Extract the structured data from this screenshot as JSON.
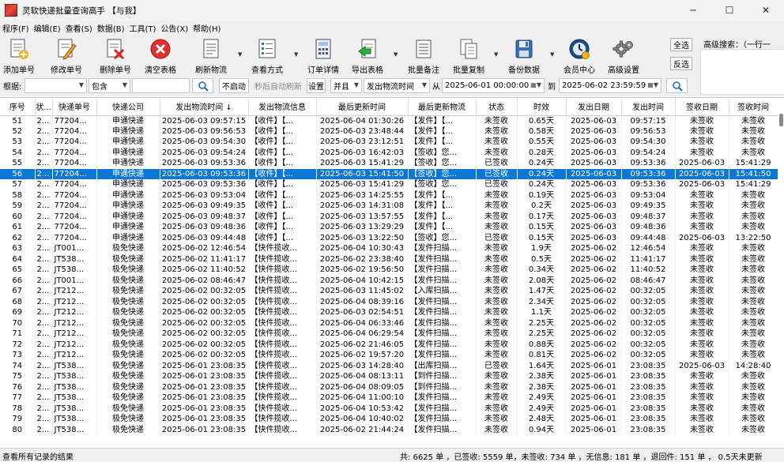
{
  "window": {
    "title": "灵软快递批量查询高手 【与我】",
    "minimize": "─",
    "maximize": "☐",
    "close": "✕"
  },
  "menu": [
    "程序(F)",
    "编辑(E)",
    "查看(S)",
    "数据(B)",
    "工具(T)",
    "公告(X)",
    "帮助(H)"
  ],
  "toolbar": {
    "add": "添加单号",
    "edit": "修改单号",
    "delete": "删除单号",
    "clear": "清空表格",
    "refresh": "刷新物流",
    "view": "查看方式",
    "detail": "订单详情",
    "export": "导出表格",
    "batch_note": "批量备注",
    "batch_copy": "批量复制",
    "backup": "备份数据",
    "member": "会员中心",
    "advanced": "高级设置",
    "select_all": "全选",
    "invert": "反选",
    "adv_search": "高级搜索：（一行一"
  },
  "filter": {
    "basis_label": "根据:",
    "basis_value": "",
    "contain_value": "包含",
    "text_value": "",
    "no_auto": "不启动",
    "auto_refresh": "秒后自动刷新",
    "settings": "设置",
    "logic": "并且",
    "time_field": "发出物流时间",
    "from_label": "从",
    "from": "2025-06-01 00:00:00",
    "to_label": "到",
    "to": "2025-06-02 23:59:59"
  },
  "columns": [
    "序号",
    "状...",
    "快递单号",
    "快递公司",
    "发出物流时间 ↓",
    "发出物流信息",
    "最后更新时间",
    "最后更新物流",
    "状态",
    "时效",
    "发出日期",
    "发出时间",
    "签收日期",
    "签收时间"
  ],
  "rows": [
    [
      "51",
      "2...",
      "77204...",
      "申通快递",
      "2025-06-03 09:57:15",
      "【收件】【...",
      "2025-06-04 01:30:26",
      "【发件】【...",
      "未签收",
      "0.65天",
      "2025-06-03",
      "09:57:15",
      "未签收",
      "未签收"
    ],
    [
      "52",
      "2...",
      "77204...",
      "申通快递",
      "2025-06-03 09:56:53",
      "【收件】【...",
      "2025-06-03 23:48:44",
      "【发件】【...",
      "未签收",
      "0.58天",
      "2025-06-03",
      "09:56:53",
      "未签收",
      "未签收"
    ],
    [
      "53",
      "2...",
      "77204...",
      "申通快递",
      "2025-06-03 09:54:30",
      "【收件】【...",
      "2025-06-03 23:12:51",
      "【发件】【...",
      "未签收",
      "0.55天",
      "2025-06-03",
      "09:54:30",
      "未签收",
      "未签收"
    ],
    [
      "54",
      "2...",
      "77204...",
      "申通快递",
      "2025-06-03 09:54:24",
      "【收件】【...",
      "2025-06-03 16:42:03",
      "【签收】您...",
      "未签收",
      "0.28天",
      "2025-06-03",
      "09:54:24",
      "未签收",
      "未签收"
    ],
    [
      "55",
      "2...",
      "77204...",
      "申通快递",
      "2025-06-03 09:53:36",
      "【收件】【...",
      "2025-06-03 15:41:29",
      "【签收】您...",
      "已签收",
      "0.24天",
      "2025-06-03",
      "09:53:36",
      "2025-06-03",
      "15:41:29"
    ],
    [
      "56",
      "2...",
      "77204...",
      "申通快递",
      "2025-06-03 09:53:36",
      "【收件】【...",
      "2025-06-03 15:41:50",
      "【签收】您...",
      "已签收",
      "0.24天",
      "2025-06-03",
      "09:53:36",
      "2025-06-03",
      "15:41:50"
    ],
    [
      "57",
      "2...",
      "77204...",
      "申通快递",
      "2025-06-03 09:53:36",
      "【收件】【...",
      "2025-06-03 15:41:29",
      "【签收】您...",
      "已签收",
      "0.24天",
      "2025-06-03",
      "09:53:36",
      "2025-06-03",
      "15:41:29"
    ],
    [
      "58",
      "2...",
      "77204...",
      "申通快递",
      "2025-06-03 09:53:04",
      "【收件】【...",
      "2025-06-03 14:25:55",
      "【发件】【...",
      "未签收",
      "0.19天",
      "2025-06-03",
      "09:53:04",
      "未签收",
      "未签收"
    ],
    [
      "59",
      "2...",
      "77204...",
      "申通快递",
      "2025-06-03 09:49:35",
      "【收件】【...",
      "2025-06-03 14:31:08",
      "【发件】【...",
      "未签收",
      "0.2天",
      "2025-06-03",
      "09:49:35",
      "未签收",
      "未签收"
    ],
    [
      "60",
      "2...",
      "77204...",
      "申通快递",
      "2025-06-03 09:48:37",
      "【收件】【...",
      "2025-06-03 13:57:55",
      "【发件】【...",
      "未签收",
      "0.17天",
      "2025-06-03",
      "09:48:37",
      "未签收",
      "未签收"
    ],
    [
      "61",
      "2...",
      "77204...",
      "申通快递",
      "2025-06-03 09:48:36",
      "【收件】【...",
      "2025-06-03 13:29:29",
      "【发件】【...",
      "未签收",
      "0.15天",
      "2025-06-03",
      "09:48:36",
      "未签收",
      "未签收"
    ],
    [
      "62",
      "2...",
      "77204...",
      "申通快递",
      "2025-06-03 09:44:48",
      "【收件】【...",
      "2025-06-03 13:22:50",
      "【签收】您...",
      "已签收",
      "0.15天",
      "2025-06-03",
      "09:44:48",
      "2025-06-03",
      "13:22:50"
    ],
    [
      "63",
      "2...",
      "JT001...",
      "极免快递",
      "2025-06-02 12:46:54",
      "【快件揽收...",
      "2025-06-04 10:30:43",
      "【发件扫描...",
      "未签收",
      "1.9天",
      "2025-06-02",
      "12:46:54",
      "未签收",
      "未签收"
    ],
    [
      "64",
      "2...",
      "JT538...",
      "极免快递",
      "2025-06-02 11:41:17",
      "【快件揽收...",
      "2025-06-02 23:38:40",
      "【发件扫描...",
      "未签收",
      "0.5天",
      "2025-06-02",
      "11:41:17",
      "未签收",
      "未签收"
    ],
    [
      "65",
      "2...",
      "JT538...",
      "极免快递",
      "2025-06-02 11:40:52",
      "【快件揽收...",
      "2025-06-02 19:56:50",
      "【发件扫描...",
      "未签收",
      "0.34天",
      "2025-06-02",
      "11:40:52",
      "未签收",
      "未签收"
    ],
    [
      "66",
      "2...",
      "JT001...",
      "极免快递",
      "2025-06-02 08:46:47",
      "【快件揽收...",
      "2025-06-04 10:42:15",
      "【发件扫描...",
      "未签收",
      "2.08天",
      "2025-06-02",
      "08:46:47",
      "未签收",
      "未签收"
    ],
    [
      "67",
      "2...",
      "JT212...",
      "极免快递",
      "2025-06-02 00:32:05",
      "【快件揽收...",
      "2025-06-03 11:45:02",
      "【入库扫描...",
      "未签收",
      "1.47天",
      "2025-06-02",
      "00:32:05",
      "未签收",
      "未签收"
    ],
    [
      "68",
      "2...",
      "JT212...",
      "极免快递",
      "2025-06-02 00:32:05",
      "【快件揽收...",
      "2025-06-04 08:39:16",
      "【发件扫描...",
      "未签收",
      "2.34天",
      "2025-06-02",
      "00:32:05",
      "未签收",
      "未签收"
    ],
    [
      "69",
      "2...",
      "JT212...",
      "极免快递",
      "2025-06-02 00:32:05",
      "【快件揽收...",
      "2025-06-03 02:54:51",
      "【发件扫描...",
      "未签收",
      "1.1天",
      "2025-06-02",
      "00:32:05",
      "未签收",
      "未签收"
    ],
    [
      "70",
      "2...",
      "JT212...",
      "极免快递",
      "2025-06-02 00:32:05",
      "【快件揽收...",
      "2025-06-04 06:33:46",
      "【发件扫描...",
      "未签收",
      "2.25天",
      "2025-06-02",
      "00:32:05",
      "未签收",
      "未签收"
    ],
    [
      "71",
      "2...",
      "JT212...",
      "极免快递",
      "2025-06-02 00:32:05",
      "【快件揽收...",
      "2025-06-04 06:29:54",
      "【发件扫描...",
      "未签收",
      "2.25天",
      "2025-06-02",
      "00:32:05",
      "未签收",
      "未签收"
    ],
    [
      "72",
      "2...",
      "JT212...",
      "极免快递",
      "2025-06-02 00:32:05",
      "【快件揽收...",
      "2025-06-02 21:46:05",
      "【发件扫描...",
      "未签收",
      "0.88天",
      "2025-06-02",
      "00:32:05",
      "未签收",
      "未签收"
    ],
    [
      "73",
      "2...",
      "JT212...",
      "极免快递",
      "2025-06-02 00:32:05",
      "【快件揽收...",
      "2025-06-02 19:57:20",
      "【发件扫描...",
      "未签收",
      "0.81天",
      "2025-06-02",
      "00:32:05",
      "未签收",
      "未签收"
    ],
    [
      "74",
      "2...",
      "JT538...",
      "极免快递",
      "2025-06-01 23:08:35",
      "【快件揽收...",
      "2025-06-03 14:28:40",
      "【出库扫描...",
      "已签收",
      "1.64天",
      "2025-06-01",
      "23:08:35",
      "2025-06-03",
      "14:28:40"
    ],
    [
      "75",
      "2...",
      "JT538...",
      "极免快递",
      "2025-06-01 23:08:35",
      "【快件揽收...",
      "2025-06-04 08:13:11",
      "【到件扫描...",
      "未签收",
      "2.38天",
      "2025-06-01",
      "23:08:35",
      "未签收",
      "未签收"
    ],
    [
      "76",
      "2...",
      "JT538...",
      "极免快递",
      "2025-06-01 23:08:35",
      "【快件揽收...",
      "2025-06-04 08:09:05",
      "【到件扫描...",
      "未签收",
      "2.38天",
      "2025-06-01",
      "23:08:35",
      "未签收",
      "未签收"
    ],
    [
      "77",
      "2...",
      "JT538...",
      "极免快递",
      "2025-06-01 23:08:35",
      "【快件揽收...",
      "2025-06-04 11:00:10",
      "【发件扫描...",
      "未签收",
      "2.49天",
      "2025-06-01",
      "23:08:35",
      "未签收",
      "未签收"
    ],
    [
      "78",
      "2...",
      "JT538...",
      "极免快递",
      "2025-06-01 23:08:35",
      "【快件揽收...",
      "2025-06-04 10:53:42",
      "【发件扫描...",
      "未签收",
      "2.49天",
      "2025-06-01",
      "23:08:35",
      "未签收",
      "未签收"
    ],
    [
      "79",
      "2...",
      "JT538...",
      "极免快递",
      "2025-06-01 23:08:35",
      "【快件揽收...",
      "2025-06-04 10:40:02",
      "【发件扫描...",
      "未签收",
      "2.48天",
      "2025-06-01",
      "23:08:35",
      "未签收",
      "未签收"
    ],
    [
      "80",
      "2...",
      "JT538...",
      "极免快递",
      "2025-06-01 23:08:35",
      "【快件揽收...",
      "2025-06-02 21:44:24",
      "【发件扫描...",
      "未签收",
      "0.94天",
      "2025-06-01",
      "23:08:35",
      "未签收",
      "未签收"
    ]
  ],
  "selected_row": "56",
  "status": {
    "left": "查看所有记录的结果",
    "right": "共: 6625 单 ，已签收:  5559 单，未签收:  734 单 ，无信息: 181 单 ，退回件: 151 单 ， 0.5天未更新"
  }
}
